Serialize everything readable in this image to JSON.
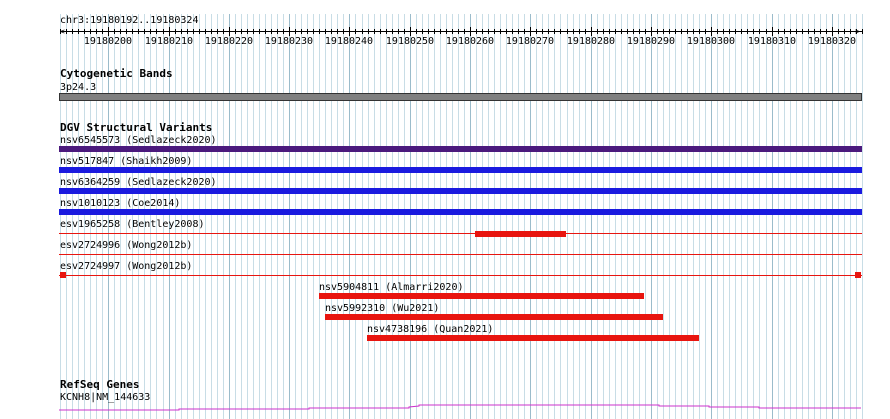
{
  "ruler": {
    "position": "chr3:19180192..19180324",
    "ticks": [
      "19180200",
      "19180210",
      "19180220",
      "19180230",
      "19180240",
      "19180250",
      "19180260",
      "19180270",
      "19180280",
      "19180290",
      "19180300",
      "19180310",
      "19180320"
    ]
  },
  "tracks": {
    "cytoband": {
      "title": "Cytogenetic Bands",
      "band": "3p24.3",
      "color": "#808080"
    },
    "dgv": {
      "title": "DGV Structural Variants",
      "variants": [
        {
          "label": "nsv6545573 (Sedlazeck2020)",
          "color": "#4b1a7d",
          "style": "full"
        },
        {
          "label": "nsv517847 (Shaikh2009)",
          "color": "#1a1adf",
          "style": "full"
        },
        {
          "label": "nsv6364259 (Sedlazeck2020)",
          "color": "#1a1adf",
          "style": "full"
        },
        {
          "label": "nsv1010123 (Coe2014)",
          "color": "#1a1adf",
          "style": "full"
        },
        {
          "label": "esv1965258 (Bentley2008)",
          "color": "#e8150f",
          "style": "partial"
        },
        {
          "label": "esv2724996 (Wong2012b)",
          "color": "#e8150f",
          "style": "line"
        },
        {
          "label": "esv2724997 (Wong2012b)",
          "color": "#e8150f",
          "style": "line-ends"
        },
        {
          "label": "nsv5904811 (Almarri2020)",
          "color": "#e8150f",
          "style": "partial"
        },
        {
          "label": "nsv5992310 (Wu2021)",
          "color": "#e8150f",
          "style": "partial"
        },
        {
          "label": "nsv4738196 (Quan2021)",
          "color": "#e8150f",
          "style": "partial"
        }
      ]
    },
    "refseq": {
      "title": "RefSeq Genes",
      "gene": "KCNH8|NM_144633",
      "color": "#cc33cc"
    }
  }
}
